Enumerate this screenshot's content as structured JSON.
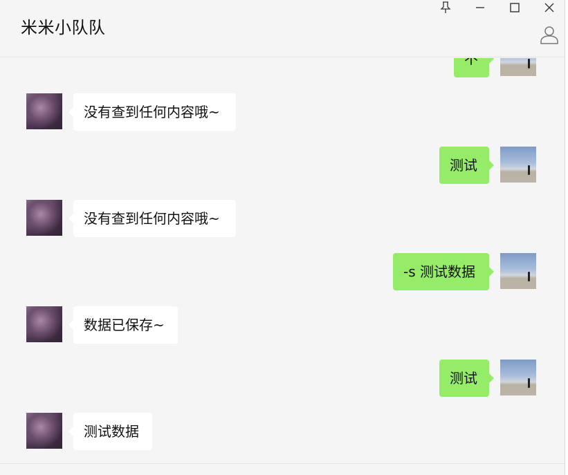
{
  "chat": {
    "title": "米米小队队"
  },
  "window_controls": [
    "pin-icon",
    "minimize-icon",
    "maximize-icon",
    "close-icon",
    "profile-icon"
  ],
  "colors": {
    "background": "#f5f5f5",
    "sent_bubble": "#95ec69",
    "received_bubble": "#ffffff"
  },
  "messages": [
    {
      "sender": "self",
      "text": "不"
    },
    {
      "sender": "bot",
      "text": "没有查到任何内容哦~"
    },
    {
      "sender": "self",
      "text": "测试"
    },
    {
      "sender": "bot",
      "text": "没有查到任何内容哦~"
    },
    {
      "sender": "self",
      "text": "-s 测试数据"
    },
    {
      "sender": "bot",
      "text": "数据已保存~"
    },
    {
      "sender": "self",
      "text": "测试"
    },
    {
      "sender": "bot",
      "text": "测试数据"
    }
  ]
}
